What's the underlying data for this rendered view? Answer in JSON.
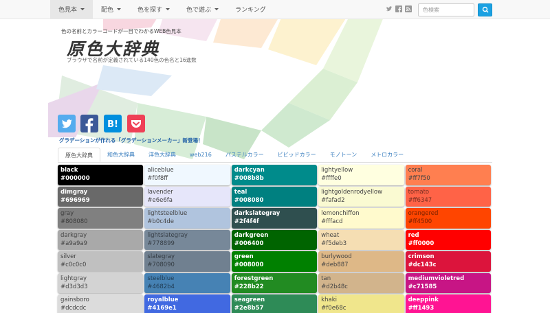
{
  "nav": {
    "items": [
      {
        "label": "色見本",
        "dropdown": true,
        "active": true
      },
      {
        "label": "配色",
        "dropdown": true,
        "active": false
      },
      {
        "label": "色を探す",
        "dropdown": true,
        "active": false
      },
      {
        "label": "色で遊ぶ",
        "dropdown": true,
        "active": false
      },
      {
        "label": "ランキング",
        "dropdown": false,
        "active": false
      }
    ],
    "search_placeholder": "色検索"
  },
  "header": {
    "tagline": "色の名前とカラーコードが一目でわかるWEB色見本",
    "logo": "原色大辞典",
    "subtitle": "ブラウザで名前が定義されている140色の色名と16進数"
  },
  "promo": "グラデーションが作れる「グラデーションメーカー」新登場！",
  "tabs": [
    "原色大辞典",
    "和色大辞典",
    "洋色大辞典",
    "web216",
    "パステルカラー",
    "ビビッドカラー",
    "モノトーン",
    "メトロカラー"
  ],
  "colors": {
    "grid": [
      [
        {
          "name": "black",
          "hex": "#000000"
        },
        {
          "name": "aliceblue",
          "hex": "#f0f8ff"
        },
        {
          "name": "darkcyan",
          "hex": "#008b8b"
        },
        {
          "name": "lightyellow",
          "hex": "#ffffe0"
        },
        {
          "name": "coral",
          "hex": "#ff7f50"
        }
      ],
      [
        {
          "name": "dimgray",
          "hex": "#696969"
        },
        {
          "name": "lavender",
          "hex": "#e6e6fa"
        },
        {
          "name": "teal",
          "hex": "#008080"
        },
        {
          "name": "lightgoldenrodyellow",
          "hex": "#fafad2"
        },
        {
          "name": "tomato",
          "hex": "#ff6347"
        }
      ],
      [
        {
          "name": "gray",
          "hex": "#808080"
        },
        {
          "name": "lightsteelblue",
          "hex": "#b0c4de"
        },
        {
          "name": "darkslategray",
          "hex": "#2f4f4f"
        },
        {
          "name": "lemonchiffon",
          "hex": "#fffacd"
        },
        {
          "name": "orangered",
          "hex": "#ff4500"
        }
      ],
      [
        {
          "name": "darkgray",
          "hex": "#a9a9a9"
        },
        {
          "name": "lightslategray",
          "hex": "#778899"
        },
        {
          "name": "darkgreen",
          "hex": "#006400"
        },
        {
          "name": "wheat",
          "hex": "#f5deb3"
        },
        {
          "name": "red",
          "hex": "#ff0000"
        }
      ],
      [
        {
          "name": "silver",
          "hex": "#c0c0c0"
        },
        {
          "name": "slategray",
          "hex": "#708090"
        },
        {
          "name": "green",
          "hex": "#008000"
        },
        {
          "name": "burlywood",
          "hex": "#deb887"
        },
        {
          "name": "crimson",
          "hex": "#dc143c"
        }
      ],
      [
        {
          "name": "lightgray",
          "hex": "#d3d3d3"
        },
        {
          "name": "steelblue",
          "hex": "#4682b4"
        },
        {
          "name": "forestgreen",
          "hex": "#228b22"
        },
        {
          "name": "tan",
          "hex": "#d2b48c"
        },
        {
          "name": "mediumvioletred",
          "hex": "#c71585"
        }
      ],
      [
        {
          "name": "gainsboro",
          "hex": "#dcdcdc"
        },
        {
          "name": "royalblue",
          "hex": "#4169e1"
        },
        {
          "name": "seagreen",
          "hex": "#2e8b57"
        },
        {
          "name": "khaki",
          "hex": "#f0e68c"
        },
        {
          "name": "deeppink",
          "hex": "#ff1493"
        }
      ]
    ]
  },
  "accent": "#1ba1e2"
}
